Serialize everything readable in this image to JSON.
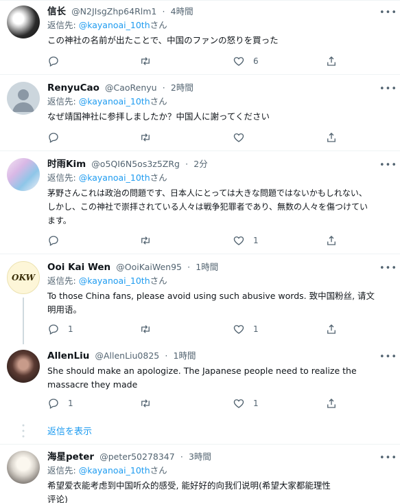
{
  "reply_prefix": "返信先:",
  "tweets": [
    {
      "name": "信长",
      "handle": "@N2JIsgZhp64Rlm1",
      "time": "4時間",
      "reply_to": "@kayanoai_10th",
      "reply_suffix": "さん",
      "text": "この神社の名前が出たことで、中国のファンの怒りを買った",
      "replies": "",
      "retweets": "",
      "likes": "6"
    },
    {
      "name": "RenyuCao",
      "handle": "@CaoRenyu",
      "time": "2時間",
      "reply_to": "@kayanoai_10th",
      "reply_suffix": "さん",
      "text": "なぜ靖国神社に参拝しましたか？中国人に謝ってください",
      "replies": "",
      "retweets": "",
      "likes": ""
    },
    {
      "name": "时雨Kim",
      "handle": "@o5QI6N5os3z5ZRg",
      "time": "2分",
      "reply_to": "@kayanoai_10th",
      "reply_suffix": "さん",
      "text_lines": [
        "茅野さんこれは政治の問題です、日本人にとっては大きな問題ではないかもしれない、",
        "しかし、この神社で崇拝されている人々は戦争犯罪者であり、無数の人々を傷つけてい",
        "ます。"
      ],
      "replies": "",
      "retweets": "",
      "likes": "1"
    },
    {
      "name": "Ooi Kai Wen",
      "handle": "@OoiKaiWen95",
      "time": "1時間",
      "avatar_text": "OKW",
      "reply_to": "@kayanoai_10th",
      "reply_suffix": "さん",
      "text_lines": [
        "To those China fans, please avoid using such abusive words. 致中国粉丝, 请文",
        "明用语。"
      ],
      "replies": "1",
      "retweets": "",
      "likes": "1"
    },
    {
      "name": "AllenLiu",
      "handle": "@AllenLiu0825",
      "time": "1時間",
      "text_lines": [
        "She should make an apologize. The Japanese people need to realize the",
        "massacre they made"
      ],
      "replies": "1",
      "retweets": "",
      "likes": "1"
    },
    {
      "name": "海星peter",
      "handle": "@peter50278347",
      "time": "3時間",
      "reply_to": "@kayanoai_10th",
      "reply_suffix": "さん",
      "text_lines": [
        "希望爱衣能考虑到中国听众的感受, 能好好的向我们说明(希望大家都能理性",
        "评论)"
      ]
    }
  ],
  "show_replies": "返信を表示",
  "time_sep": "·",
  "colors": {
    "link": "#1d9bf0",
    "secondary": "#536471",
    "divider": "#eff3f4"
  }
}
